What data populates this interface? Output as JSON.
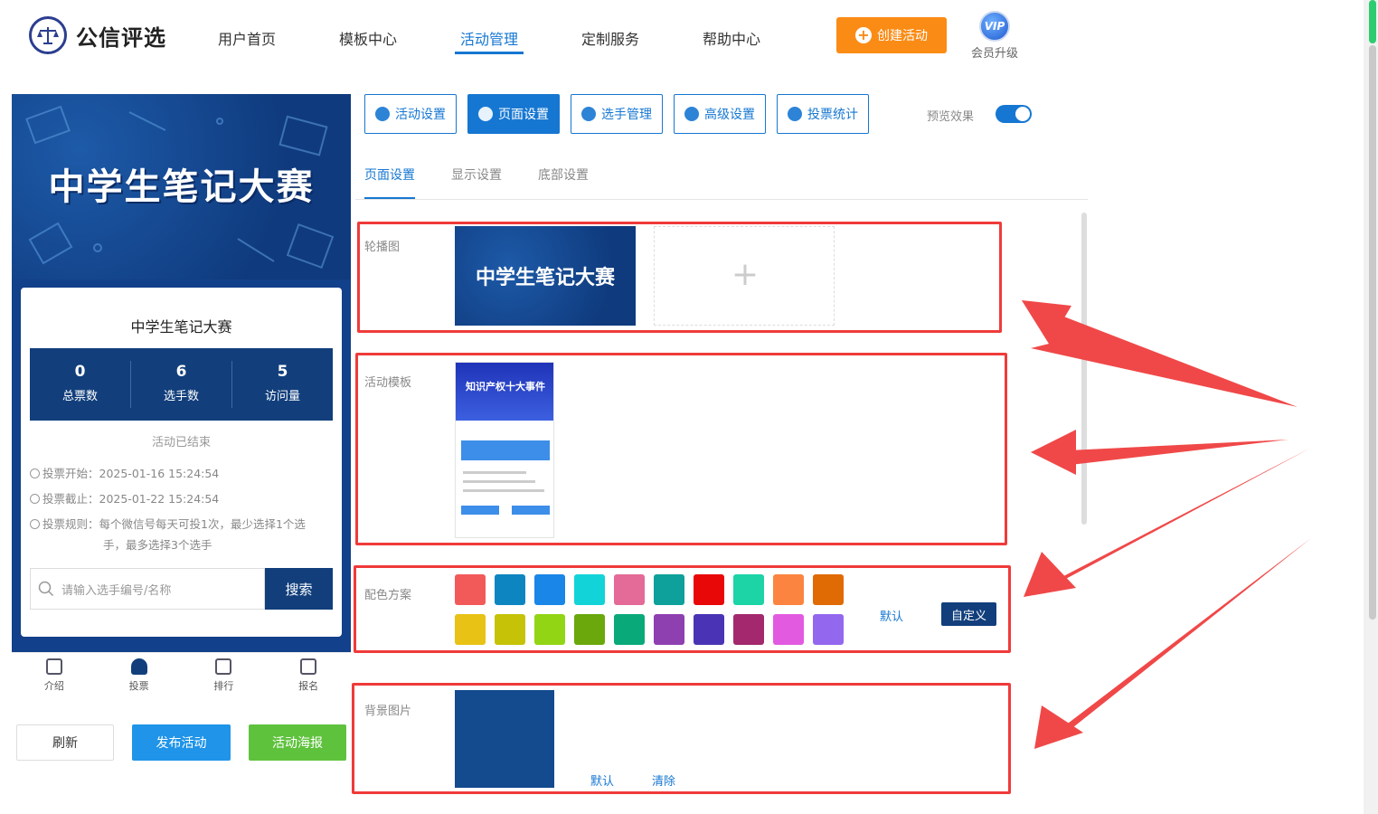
{
  "header": {
    "logo_text": "公信评选",
    "nav": [
      "用户首页",
      "模板中心",
      "活动管理",
      "定制服务",
      "帮助中心"
    ],
    "active_nav": "活动管理",
    "create_label": "创建活动",
    "vip_badge": "VIP",
    "vip_label": "会员升级"
  },
  "preview": {
    "banner_title": "中学生笔记大赛",
    "card_title": "中学生笔记大赛",
    "stats": [
      {
        "value": "0",
        "label": "总票数"
      },
      {
        "value": "6",
        "label": "选手数"
      },
      {
        "value": "5",
        "label": "访问量"
      }
    ],
    "status": "活动已结束",
    "vote_start": "投票开始：2025-01-16 15:24:54",
    "vote_end": "投票截止：2025-01-22 15:24:54",
    "rule_line1": "投票规则：每个微信号每天可投1次，最少选择1个选",
    "rule_line2": "手，最多选择3个选手",
    "search_placeholder": "请输入选手编号/名称",
    "search_button": "搜索",
    "tabbar": [
      "介绍",
      "投票",
      "排行",
      "报名"
    ]
  },
  "actions": {
    "refresh": "刷新",
    "publish": "发布活动",
    "poster": "活动海报"
  },
  "toolbar": {
    "buttons": [
      "活动设置",
      "页面设置",
      "选手管理",
      "高级设置",
      "投票统计"
    ],
    "active": "页面设置",
    "preview_toggle_label": "预览效果",
    "preview_toggle_on": true
  },
  "subtabs": [
    "页面设置",
    "显示设置",
    "底部设置"
  ],
  "settings": {
    "carousel_label": "轮播图",
    "carousel_thumb_title": "中学生笔记大赛",
    "template_label": "活动模板",
    "template_title": "知识产权十大事件",
    "color_label": "配色方案",
    "colors_row1": [
      "#f25a5a",
      "#0d85c0",
      "#1a86e8",
      "#12d3d8",
      "#e46a97",
      "#0ea09a",
      "#e80808",
      "#1cd4a6",
      "#fb8540",
      "#e06b05"
    ],
    "colors_row2": [
      "#e8c214",
      "#c6c207",
      "#92d514",
      "#6aa80c",
      "#0aa97a",
      "#8e3fb0",
      "#4a34b5",
      "#a3286e",
      "#e25ae0",
      "#9367ee"
    ],
    "color_default": "默认",
    "color_custom": "自定义",
    "bg_label": "背景图片",
    "bg_default": "默认",
    "bg_clear": "清除"
  }
}
